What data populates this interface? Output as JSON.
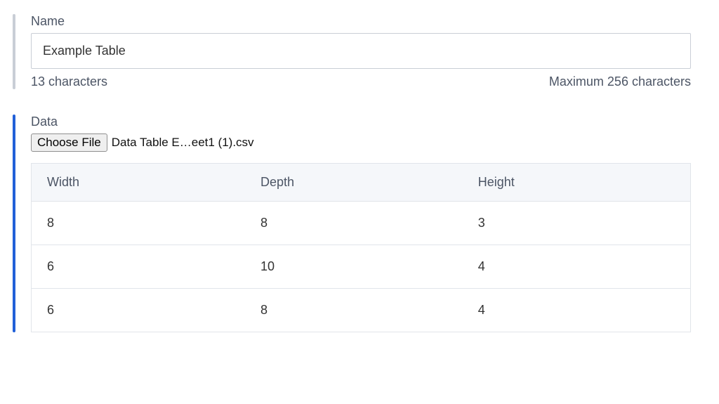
{
  "nameSection": {
    "label": "Name",
    "value": "Example Table",
    "char_count_text": "13 characters",
    "max_text": "Maximum 256 characters"
  },
  "dataSection": {
    "label": "Data",
    "choose_file_label": "Choose File",
    "selected_file": "Data Table E…eet1 (1).csv",
    "columns": [
      "Width",
      "Depth",
      "Height"
    ],
    "rows": [
      [
        "8",
        "8",
        "3"
      ],
      [
        "6",
        "10",
        "4"
      ],
      [
        "6",
        "8",
        "4"
      ]
    ]
  }
}
